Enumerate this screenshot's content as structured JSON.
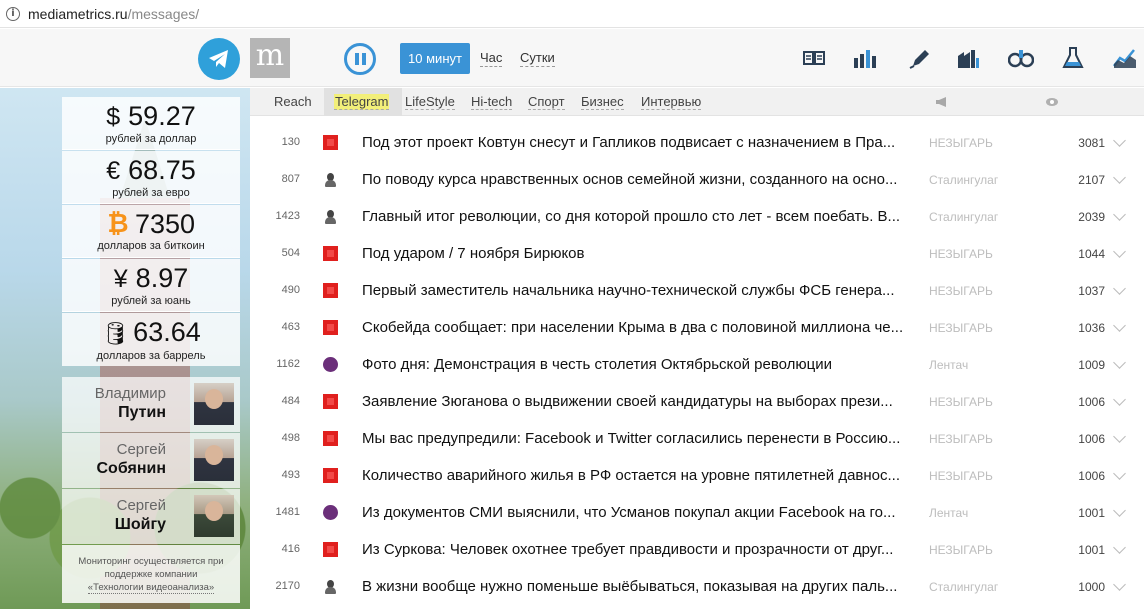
{
  "browser": {
    "url_host": "mediametrics.ru",
    "url_path": "/messages/"
  },
  "header": {
    "logo_letter": "m",
    "period_active": "10 минут",
    "period_hour": "Час",
    "period_day": "Сутки",
    "icons": [
      "newspaper-icon",
      "bar-chart-icon",
      "pen-icon",
      "factory-icon",
      "binoculars-icon",
      "flask-icon",
      "line-chart-icon"
    ]
  },
  "categories": {
    "reach": "Reach",
    "items": [
      "Telegram",
      "LifeStyle",
      "Hi-tech",
      "Спорт",
      "Бизнес",
      "Интервью"
    ],
    "selected": "Telegram"
  },
  "rates": [
    {
      "symbol": "$",
      "value": "59.27",
      "label": "рублей за доллар"
    },
    {
      "symbol": "€",
      "value": "68.75",
      "label": "рублей за евро"
    },
    {
      "symbol": "bitcoin-icon",
      "value": "7350",
      "label": "долларов за биткоин"
    },
    {
      "symbol": "¥",
      "value": "8.97",
      "label": "рублей за юань"
    },
    {
      "symbol": "oil-barrel-icon",
      "value": "63.64",
      "label": "долларов за баррель"
    }
  ],
  "persons": [
    {
      "first": "Владимир",
      "last": "Путин"
    },
    {
      "first": "Сергей",
      "last": "Собянин"
    },
    {
      "first": "Сергей",
      "last": "Шойгу"
    }
  ],
  "note": {
    "text": "Мониторинг осуществляется при поддержке компании",
    "link": "«Технологии видеоанализа»"
  },
  "rows": [
    {
      "reach": "130",
      "icon": "red",
      "title": "Под этот проект Ковтун снесут и Гапликов подвисает с назначением в Пра...",
      "channel": "НЕЗЫГАРЬ",
      "views": "3081"
    },
    {
      "reach": "807",
      "icon": "dark",
      "title": "По поводу курса нравственных основ семейной жизни, созданного на осно...",
      "channel": "Сталингулаг",
      "views": "2107"
    },
    {
      "reach": "1423",
      "icon": "dark",
      "title": "Главный итог революции, со дня которой прошло сто лет - всем поебать. В...",
      "channel": "Сталингулаг",
      "views": "2039"
    },
    {
      "reach": "504",
      "icon": "red",
      "title": "Под ударом / 7 ноября Бирюков",
      "channel": "НЕЗЫГАРЬ",
      "views": "1044"
    },
    {
      "reach": "490",
      "icon": "red",
      "title": "Первый заместитель начальника научно-технической службы ФСБ генера...",
      "channel": "НЕЗЫГАРЬ",
      "views": "1037"
    },
    {
      "reach": "463",
      "icon": "red",
      "title": "Скобейда сообщает: при населении Крыма в два с половиной миллиона че...",
      "channel": "НЕЗЫГАРЬ",
      "views": "1036"
    },
    {
      "reach": "1162",
      "icon": "purple",
      "title": "Фото дня: Демонстрация в честь столетия Октябрьской революции",
      "channel": "Лентач",
      "views": "1009"
    },
    {
      "reach": "484",
      "icon": "red",
      "title": "Заявление Зюганова о выдвижении своей кандидатуры на выборах прези...",
      "channel": "НЕЗЫГАРЬ",
      "views": "1006"
    },
    {
      "reach": "498",
      "icon": "red",
      "title": "Мы вас предупредили: Facebook и Twitter согласились перенести в Россию...",
      "channel": "НЕЗЫГАРЬ",
      "views": "1006"
    },
    {
      "reach": "493",
      "icon": "red",
      "title": "Количество аварийного жилья в РФ остается на уровне пятилетней давнос...",
      "channel": "НЕЗЫГАРЬ",
      "views": "1006"
    },
    {
      "reach": "1481",
      "icon": "purple",
      "title": "Из документов СМИ выяснили, что Усманов покупал акции Facebook на го...",
      "channel": "Лентач",
      "views": "1001"
    },
    {
      "reach": "416",
      "icon": "red",
      "title": "Из Суркова: Человек охотнее требует правдивости и прозрачности от друг...",
      "channel": "НЕЗЫГАРЬ",
      "views": "1001"
    },
    {
      "reach": "2170",
      "icon": "dark",
      "title": "В жизни вообще нужно поменьше выёбываться, показывая на других паль...",
      "channel": "Сталингулаг",
      "views": "1000"
    }
  ]
}
